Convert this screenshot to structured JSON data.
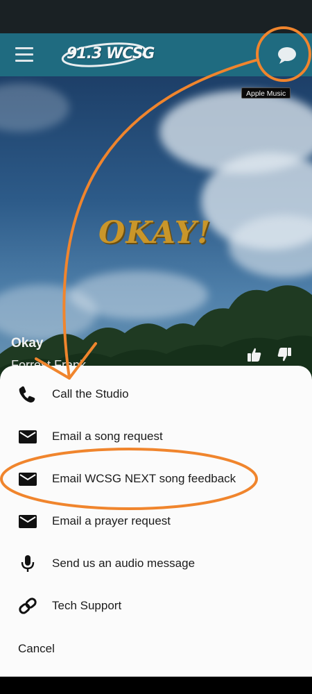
{
  "app": {
    "logo_text": "91.3 WCSG",
    "menu_icon": "hamburger-menu-icon",
    "chat_icon": "chat-bubble-icon"
  },
  "now_playing": {
    "badge": "Apple Music",
    "album_art_text": "OKAY!",
    "song_title": "Okay",
    "artist": "Forrest Frank"
  },
  "sheet": {
    "items": [
      {
        "label": "Call the Studio",
        "icon": "phone-icon"
      },
      {
        "label": "Email a song request",
        "icon": "envelope-icon"
      },
      {
        "label": "Email WCSG NEXT song feedback",
        "icon": "envelope-icon"
      },
      {
        "label": "Email a prayer request",
        "icon": "envelope-icon"
      },
      {
        "label": "Send us an audio message",
        "icon": "microphone-icon"
      },
      {
        "label": "Tech Support",
        "icon": "link-icon"
      }
    ],
    "cancel": "Cancel"
  },
  "colors": {
    "app_bar": "#1f6b80",
    "annotation": "#f0852d",
    "album_text": "#c9962a",
    "sheet_bg": "#fbfbfb"
  }
}
